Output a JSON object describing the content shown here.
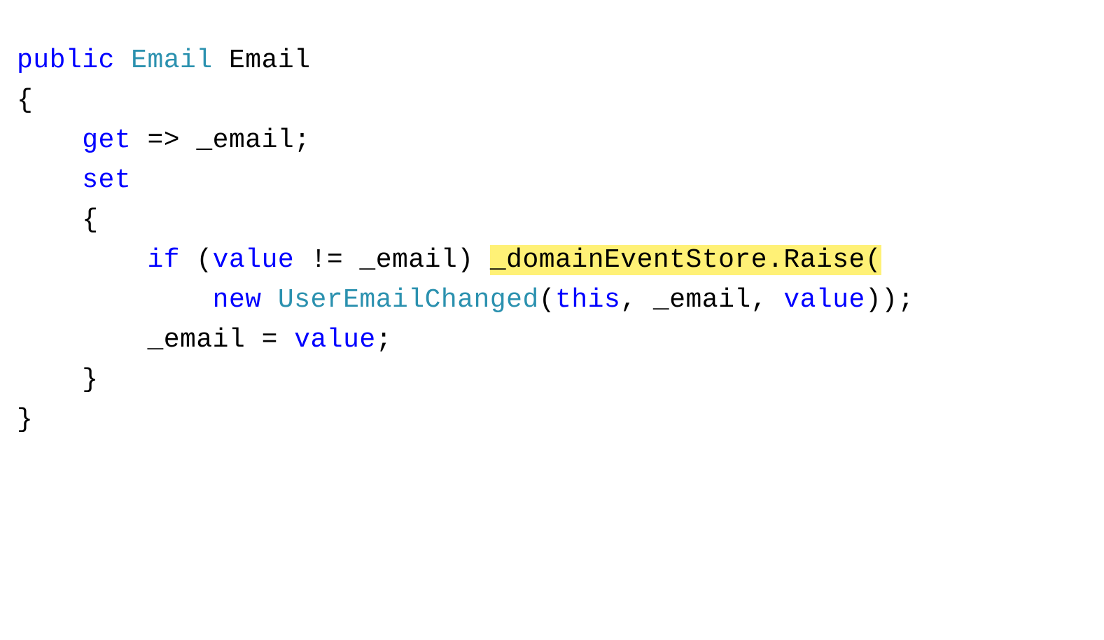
{
  "tokens": {
    "public": "public",
    "emailType": "Email",
    "emailProp": "Email",
    "braceOpen": "{",
    "braceClose": "}",
    "get": "get",
    "getBody": "=> _email;",
    "set": "set",
    "if": "if",
    "parenOpen": "(",
    "value": "value",
    "neqEmail": "!= _email)",
    "domainRaise": "_domainEventStore.Raise(",
    "new": "new",
    "userEmailChanged": "UserEmailChanged",
    "this": "this",
    "commaEmail": ", _email,",
    "closeCall": "));",
    "assignEmail": "_email =",
    "semicolon": ";"
  }
}
